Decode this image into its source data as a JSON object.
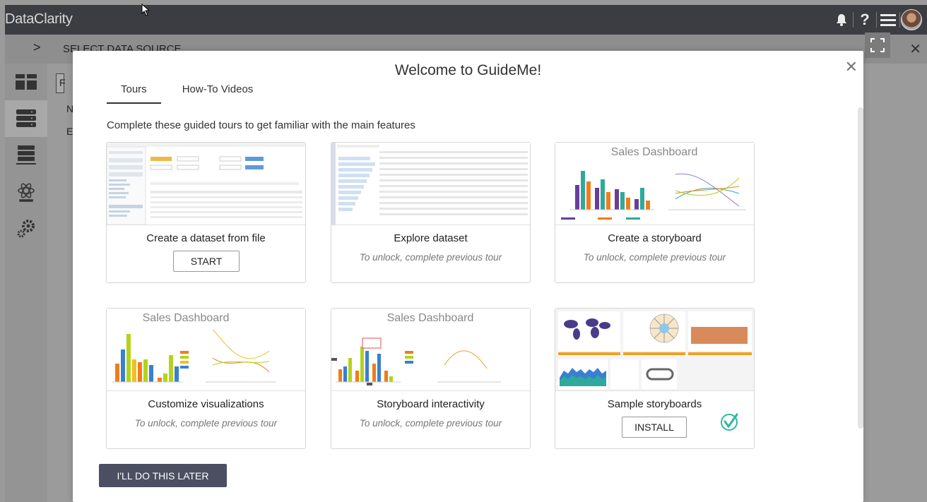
{
  "app": {
    "brand": "DataClarity",
    "subbar_label": "SELECT DATA SOURCE",
    "bg_fragments": [
      "F",
      "N",
      "E"
    ]
  },
  "icons": {
    "bell": "bell-icon",
    "help": "help-icon",
    "menu": "hamburger-menu-icon",
    "expand": "fullscreen-icon",
    "chevron": "chevron-right-icon"
  },
  "modal": {
    "title": "Welcome to GuideMe!",
    "tabs": [
      {
        "label": "Tours",
        "active": true
      },
      {
        "label": "How-To Videos",
        "active": false
      }
    ],
    "subtitle": "Complete these guided tours to get familiar with the main features",
    "later_label": "I'LL DO THIS LATER",
    "cards": [
      {
        "title": "Create a dataset from file",
        "button": "START"
      },
      {
        "title": "Explore dataset",
        "status": "To unlock, complete previous tour"
      },
      {
        "title": "Create a storyboard",
        "status": "To unlock, complete previous tour",
        "thumb_title": "Sales Dashboard"
      },
      {
        "title": "Customize visualizations",
        "status": "To unlock, complete previous tour",
        "thumb_title": "Sales Dashboard"
      },
      {
        "title": "Storyboard interactivity",
        "status": "To unlock, complete previous tour",
        "thumb_title": "Sales Dashboard"
      },
      {
        "title": "Sample storyboards",
        "button": "INSTALL",
        "completed": true
      }
    ]
  },
  "colors": {
    "topbar": "#3b3d42",
    "primary_button": "#4b4f61",
    "check": "#2eb8a5",
    "bar_teal": "#2ea99b",
    "bar_purple": "#6a3d9a",
    "bar_orange": "#ef7d1a",
    "bar_lime": "#b5d21a",
    "bar_blue": "#3a7fd0"
  }
}
